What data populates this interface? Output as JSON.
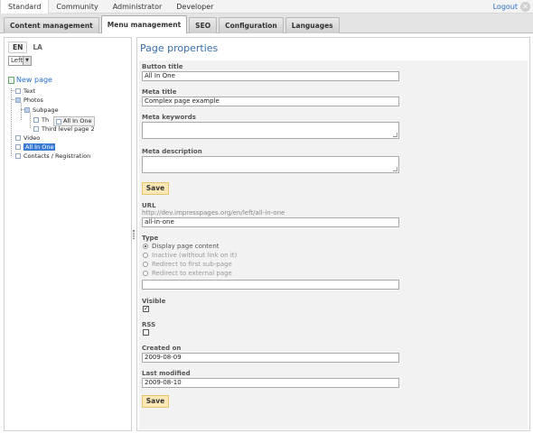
{
  "top_menu": {
    "items": [
      "Standard",
      "Community",
      "Administrator",
      "Developer"
    ],
    "logout": "Logout"
  },
  "tabs": [
    "Content management",
    "Menu management",
    "SEO",
    "Configuration",
    "Languages"
  ],
  "left": {
    "languages": [
      "EN",
      "LA"
    ],
    "zone_select": "Left",
    "new_page": "New page",
    "tree": {
      "text": "Text",
      "photos": "Photos",
      "subpage": "Subpage",
      "child1": "Th",
      "child2": "Third level page 2",
      "video": "Video",
      "all_in_one": "All In One",
      "contacts": "Contacts / Registration"
    },
    "drag_ghost": "All In One"
  },
  "page_properties": {
    "title": "Page properties",
    "button_title_label": "Button title",
    "button_title_value": "All In One",
    "meta_title_label": "Meta title",
    "meta_title_value": "Complex page example",
    "meta_keywords_label": "Meta keywords",
    "meta_description_label": "Meta description",
    "save": "Save",
    "url_label": "URL",
    "url_hint": "http://dev.impresspages.org/en/left/all-in-one",
    "url_value": "all-in-one",
    "type_label": "Type",
    "type_options": [
      "Display page content",
      "Inactive (without link on it)",
      "Redirect to first sub-page",
      "Redirect to external page"
    ],
    "visible_label": "Visible",
    "rss_label": "RSS",
    "created_label": "Created on",
    "created_value": "2009-08-09",
    "modified_label": "Last modified",
    "modified_value": "2009-08-10"
  }
}
